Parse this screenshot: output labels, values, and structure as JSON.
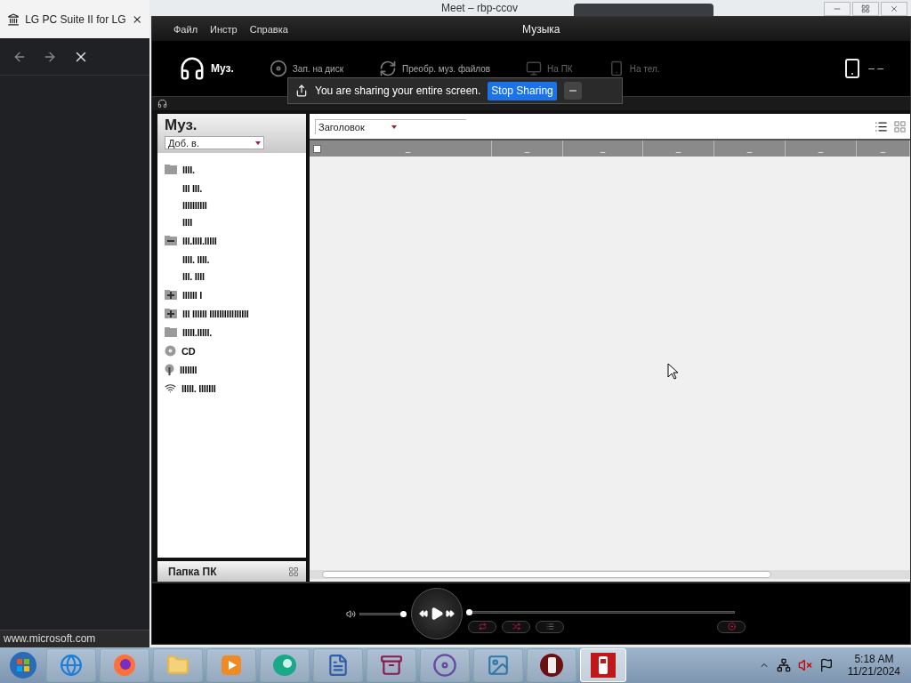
{
  "browser": {
    "tab_title": "LG PC Suite II for LG",
    "status_url": "www.microsoft.com"
  },
  "background_window": {
    "title": "Meet – rbp-ccov"
  },
  "app": {
    "menu": [
      "Файл",
      "Инстр",
      "Справка"
    ],
    "title": "Музыка",
    "toolbar": [
      {
        "label": "Муз.",
        "kind": "music",
        "selected": true,
        "disabled": false
      },
      {
        "label": "Зап. на диск",
        "kind": "disc",
        "selected": false,
        "disabled": false
      },
      {
        "label": "Преобр. муз. файлов",
        "kind": "convert",
        "selected": false,
        "disabled": false
      },
      {
        "label": "На ПК",
        "kind": "to_pc",
        "selected": false,
        "disabled": true
      },
      {
        "label": "На тел.",
        "kind": "to_phone",
        "selected": false,
        "disabled": true
      }
    ],
    "phone_status": "– –",
    "share_bar": {
      "message": "You are sharing your entire screen.",
      "button": "Stop Sharing"
    },
    "library": {
      "title": "Муз.",
      "add_to": "Доб. в.",
      "footer": "Папка ПК",
      "tree": [
        {
          "label": "IIII.",
          "kind": "folder",
          "children": [
            {
              "label": "III III."
            },
            {
              "label": "IIIIIIIIII"
            },
            {
              "label": "IIII"
            }
          ]
        },
        {
          "label": "III.IIII.IIIII",
          "kind": "folder",
          "expanded": true,
          "children": [
            {
              "label": "IIII. IIII."
            },
            {
              "label": "III. IIII"
            }
          ]
        },
        {
          "label": "IIIIII I",
          "kind": "folder",
          "expanded": false
        },
        {
          "label": "III IIIIII IIIIIIIIIIIIIIII",
          "kind": "folder",
          "expanded": false
        },
        {
          "label": "IIIII.IIIII.",
          "kind": "folder"
        },
        {
          "label": "CD",
          "kind": "cd"
        },
        {
          "label": "IIIIIII",
          "kind": "device"
        },
        {
          "label": "IIIII. IIIIIII",
          "kind": "wireless"
        }
      ]
    },
    "list": {
      "sort": "Заголовок",
      "select_all_checked": false,
      "columns": [
        "–",
        "–",
        "–",
        "–",
        "–",
        "–",
        "–"
      ]
    },
    "player": {
      "volume": {
        "level": 0.95
      },
      "progress": {
        "level": 0
      }
    }
  },
  "taskbar": {
    "apps": [
      {
        "kind": "ie",
        "active": false
      },
      {
        "kind": "firefox",
        "active": false
      },
      {
        "kind": "explorer",
        "active": false
      },
      {
        "kind": "media",
        "active": false
      },
      {
        "kind": "orb",
        "active": false
      },
      {
        "kind": "document",
        "active": false
      },
      {
        "kind": "archive",
        "active": false
      },
      {
        "kind": "dvd",
        "active": false
      },
      {
        "kind": "photo",
        "active": false
      },
      {
        "kind": "phone",
        "active": false
      },
      {
        "kind": "lg",
        "active": true
      }
    ],
    "time": "5:18 AM",
    "date": "11/21/2024"
  }
}
